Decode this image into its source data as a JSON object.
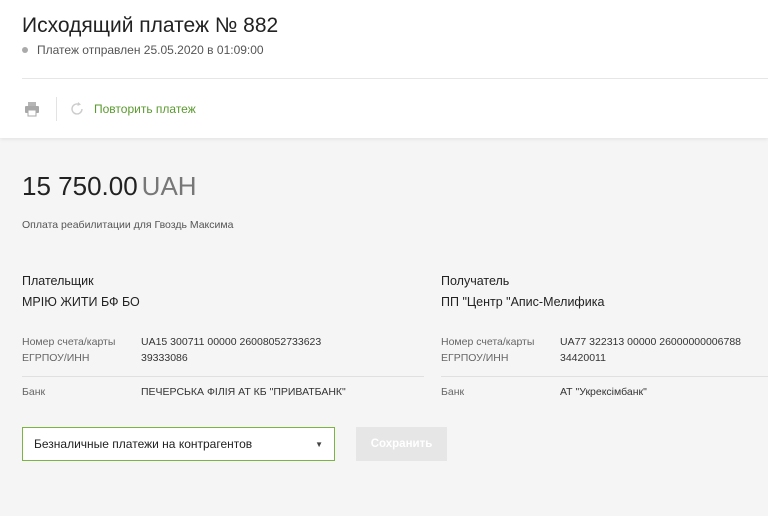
{
  "header": {
    "title": "Исходящий платеж № 882",
    "status": "Платеж отправлен 25.05.2020 в 01:09:00"
  },
  "toolbar": {
    "print_icon": "printer-icon",
    "repeat_icon": "refresh-icon",
    "repeat_label": "Повторить платеж"
  },
  "payment": {
    "amount": "15 750.00",
    "currency": "UAH",
    "purpose": "Оплата реабилитации для Гвоздь Максима"
  },
  "payer": {
    "role": "Плательщик",
    "name": "МРІЮ ЖИТИ БФ БО",
    "account_label": "Номер счета/карты",
    "account": "UA15 300711 00000 26008052733623",
    "tax_label": "ЕГРПОУ/ИНН",
    "tax_id": "39333086",
    "bank_label": "Банк",
    "bank": "ПЕЧЕРСЬКА ФІЛІЯ АТ КБ \"ПРИВАТБАНК\""
  },
  "recipient": {
    "role": "Получатель",
    "name": "ПП \"Центр \"Апис-Мелифика",
    "account_label": "Номер счета/карты",
    "account": "UA77 322313 00000 26000000006788",
    "tax_label": "ЕГРПОУ/ИНН",
    "tax_id": "34420011",
    "bank_label": "Банк",
    "bank": "АТ \"Укрексімбанк\""
  },
  "form": {
    "category_value": "Безналичные платежи на контрагентов",
    "save_label": "Сохранить"
  },
  "colors": {
    "accent_green": "#5a9a2e",
    "select_border": "#7cb342"
  }
}
